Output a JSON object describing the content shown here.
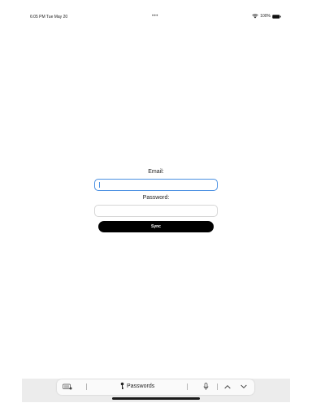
{
  "status_bar": {
    "time": "6:05 PM   Tue May 20",
    "dots": "•••",
    "battery_percent": "100%"
  },
  "form": {
    "email_label": "Email:",
    "email_value": "",
    "password_label": "Password:",
    "password_value": "",
    "sync_label": "Sync"
  },
  "keyboard_toolbar": {
    "passwords_label": "Passwords",
    "icons": [
      "keyboard-icon",
      "key-icon",
      "microphone-icon",
      "chevron-up-icon",
      "chevron-down-icon"
    ]
  },
  "colors": {
    "focus_border": "#4a90e2",
    "button_bg": "#000000",
    "toolbar_bg": "#ececec"
  }
}
